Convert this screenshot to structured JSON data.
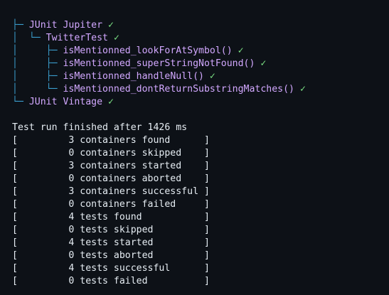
{
  "tree": {
    "root": {
      "prefix": "├─ ",
      "label": "JUnit Jupiter",
      "status": "✓"
    },
    "class_node": {
      "prefix": "│  └─ ",
      "label": "TwitterTest",
      "status": "✓"
    },
    "tests": [
      {
        "prefix": "│     ├─ ",
        "label": "isMentionned_lookForAtSymbol()",
        "status": "✓"
      },
      {
        "prefix": "│     ├─ ",
        "label": "isMentionned_superStringNotFound()",
        "status": "✓"
      },
      {
        "prefix": "│     ├─ ",
        "label": "isMentionned_handleNull()",
        "status": "✓"
      },
      {
        "prefix": "│     └─ ",
        "label": "isMentionned_dontReturnSubstringMatches()",
        "status": "✓"
      }
    ],
    "vintage": {
      "prefix": "└─ ",
      "label": "JUnit Vintage",
      "status": "✓"
    }
  },
  "summary": {
    "header": "Test run finished after 1426 ms",
    "lines": [
      "[         3 containers found      ]",
      "[         0 containers skipped    ]",
      "[         3 containers started    ]",
      "[         0 containers aborted    ]",
      "[         3 containers successful ]",
      "[         0 containers failed     ]",
      "[         4 tests found           ]",
      "[         0 tests skipped         ]",
      "[         4 tests started         ]",
      "[         0 tests aborted         ]",
      "[         4 tests successful      ]",
      "[         0 tests failed          ]"
    ]
  },
  "colors": {
    "background": "#0d1117",
    "tree_guides": "#3b9fcf",
    "node_text": "#d2a8ff",
    "success_check": "#7ee787",
    "plain_text": "#e6edf3"
  }
}
